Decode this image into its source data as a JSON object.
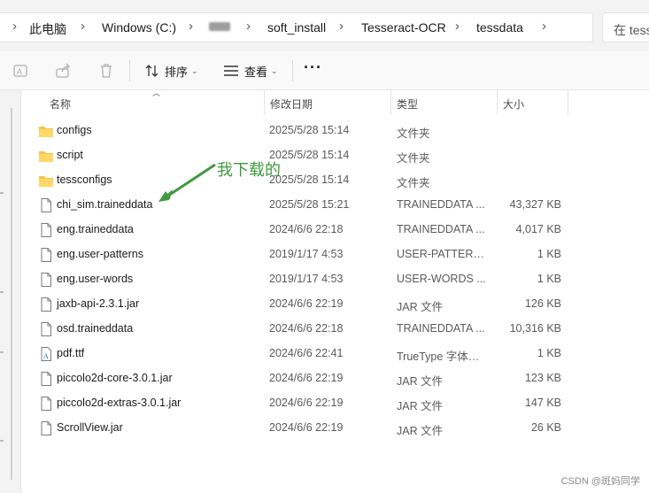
{
  "breadcrumb": {
    "items": [
      "此电脑",
      "Windows (C:)",
      "soft_install",
      "Tesseract-OCR",
      "tessdata"
    ],
    "separator": ">"
  },
  "search": {
    "placeholder": "在 tess"
  },
  "toolbar": {
    "sort_label": "排序",
    "view_label": "查看",
    "more_label": "···"
  },
  "columns": {
    "name": "名称",
    "date": "修改日期",
    "type": "类型",
    "size": "大小"
  },
  "files": [
    {
      "name": "configs",
      "date": "2025/5/28 15:14",
      "type": "文件夹",
      "size": "",
      "icon": "folder-icon"
    },
    {
      "name": "script",
      "date": "2025/5/28 15:14",
      "type": "文件夹",
      "size": "",
      "icon": "folder-icon"
    },
    {
      "name": "tessconfigs",
      "date": "2025/5/28 15:14",
      "type": "文件夹",
      "size": "",
      "icon": "folder-icon"
    },
    {
      "name": "chi_sim.traineddata",
      "date": "2025/5/28 15:21",
      "type": "TRAINEDDATA ...",
      "size": "43,327 KB",
      "icon": "file-icon"
    },
    {
      "name": "eng.traineddata",
      "date": "2024/6/6 22:18",
      "type": "TRAINEDDATA ...",
      "size": "4,017 KB",
      "icon": "file-icon"
    },
    {
      "name": "eng.user-patterns",
      "date": "2019/1/17 4:53",
      "type": "USER-PATTERNS...",
      "size": "1 KB",
      "icon": "file-icon"
    },
    {
      "name": "eng.user-words",
      "date": "2019/1/17 4:53",
      "type": "USER-WORDS ...",
      "size": "1 KB",
      "icon": "file-icon"
    },
    {
      "name": "jaxb-api-2.3.1.jar",
      "date": "2024/6/6 22:19",
      "type": "JAR 文件",
      "size": "126 KB",
      "icon": "file-icon"
    },
    {
      "name": "osd.traineddata",
      "date": "2024/6/6 22:18",
      "type": "TRAINEDDATA ...",
      "size": "10,316 KB",
      "icon": "file-icon"
    },
    {
      "name": "pdf.ttf",
      "date": "2024/6/6 22:41",
      "type": "TrueType 字体文件",
      "size": "1 KB",
      "icon": "font-file-icon"
    },
    {
      "name": "piccolo2d-core-3.0.1.jar",
      "date": "2024/6/6 22:19",
      "type": "JAR 文件",
      "size": "123 KB",
      "icon": "file-icon"
    },
    {
      "name": "piccolo2d-extras-3.0.1.jar",
      "date": "2024/6/6 22:19",
      "type": "JAR 文件",
      "size": "147 KB",
      "icon": "file-icon"
    },
    {
      "name": "ScrollView.jar",
      "date": "2024/6/6 22:19",
      "type": "JAR 文件",
      "size": "26 KB",
      "icon": "file-icon"
    }
  ],
  "annotation": {
    "text": "我下载的",
    "color": "#3e9a3e"
  },
  "watermark": "CSDN @斑妈同学",
  "colors": {
    "folder": "#f4c44a",
    "accent": "#0067c0"
  }
}
